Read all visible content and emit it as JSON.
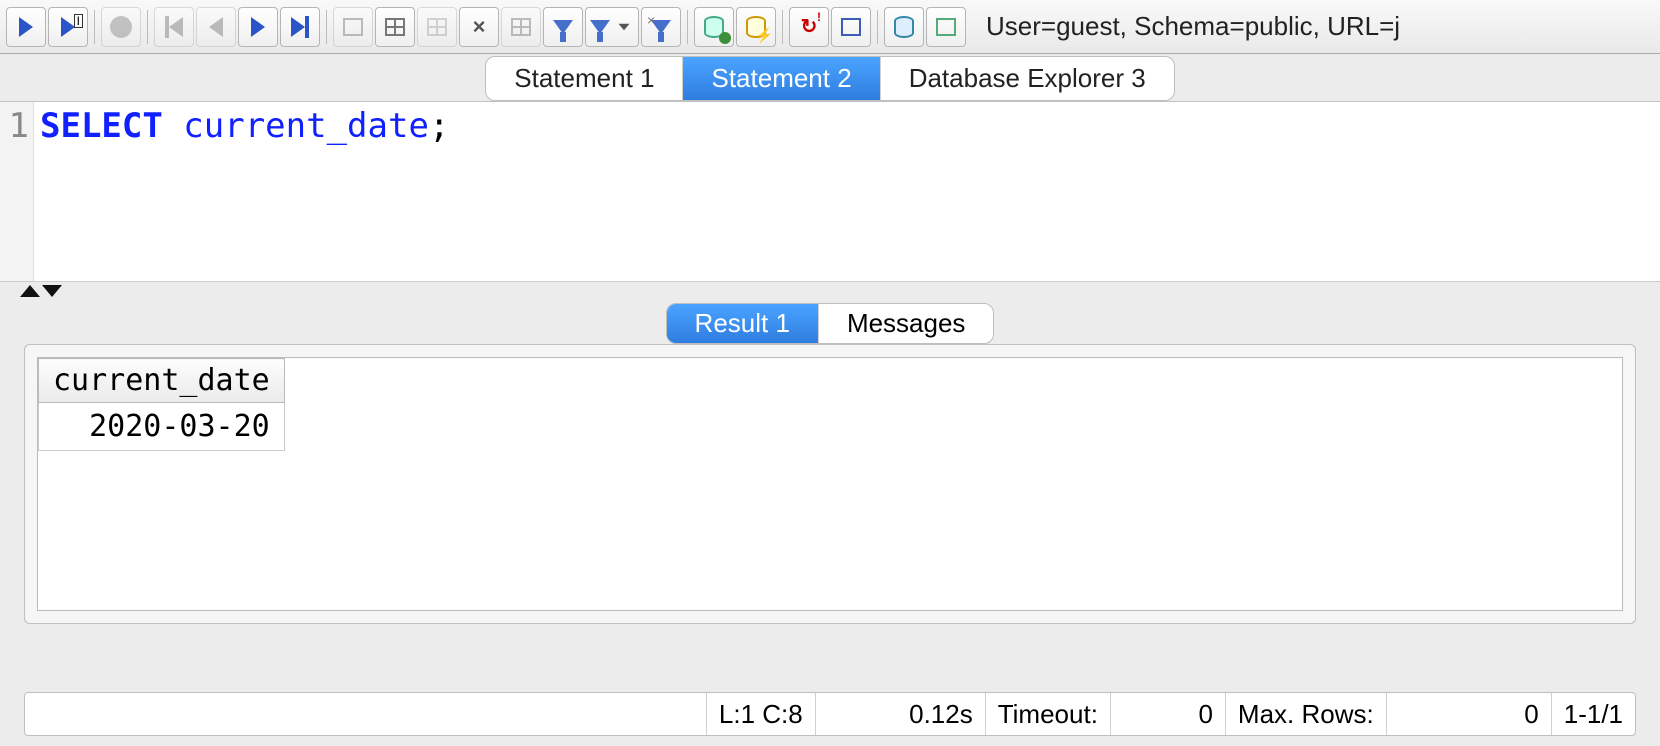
{
  "toolbar": {
    "icons": [
      "run-icon",
      "run-to-cursor-icon",
      "stop-icon",
      "first-icon",
      "prev-icon",
      "next-icon",
      "last-icon",
      "save-icon",
      "insert-row-icon",
      "duplicate-row-icon",
      "delete-row-icon",
      "commit-icon",
      "filter-icon",
      "filter-dropdown-icon",
      "clear-filter-icon",
      "db-refresh-icon",
      "db-script-icon",
      "reconnect-icon",
      "schema-icon",
      "db-browser-icon",
      "db-details-icon"
    ],
    "connection_info": "User=guest, Schema=public, URL=j"
  },
  "tabs": {
    "items": [
      {
        "label": "Statement 1",
        "active": false
      },
      {
        "label": "Statement 2",
        "active": true
      },
      {
        "label": "Database Explorer 3",
        "active": false
      }
    ]
  },
  "editor": {
    "line_number": "1",
    "keyword": "SELECT",
    "rest": " current_date",
    "terminator": ";"
  },
  "result_tabs": {
    "items": [
      {
        "label": "Result 1",
        "active": true
      },
      {
        "label": "Messages",
        "active": false
      }
    ]
  },
  "result": {
    "columns": [
      "current_date"
    ],
    "rows": [
      [
        "2020-03-20"
      ]
    ]
  },
  "status": {
    "cursor": "L:1 C:8",
    "elapsed": "0.12s",
    "timeout_label": "Timeout:",
    "timeout_value": "0",
    "maxrows_label": "Max. Rows:",
    "maxrows_value": "0",
    "rowrange": "1-1/1"
  }
}
